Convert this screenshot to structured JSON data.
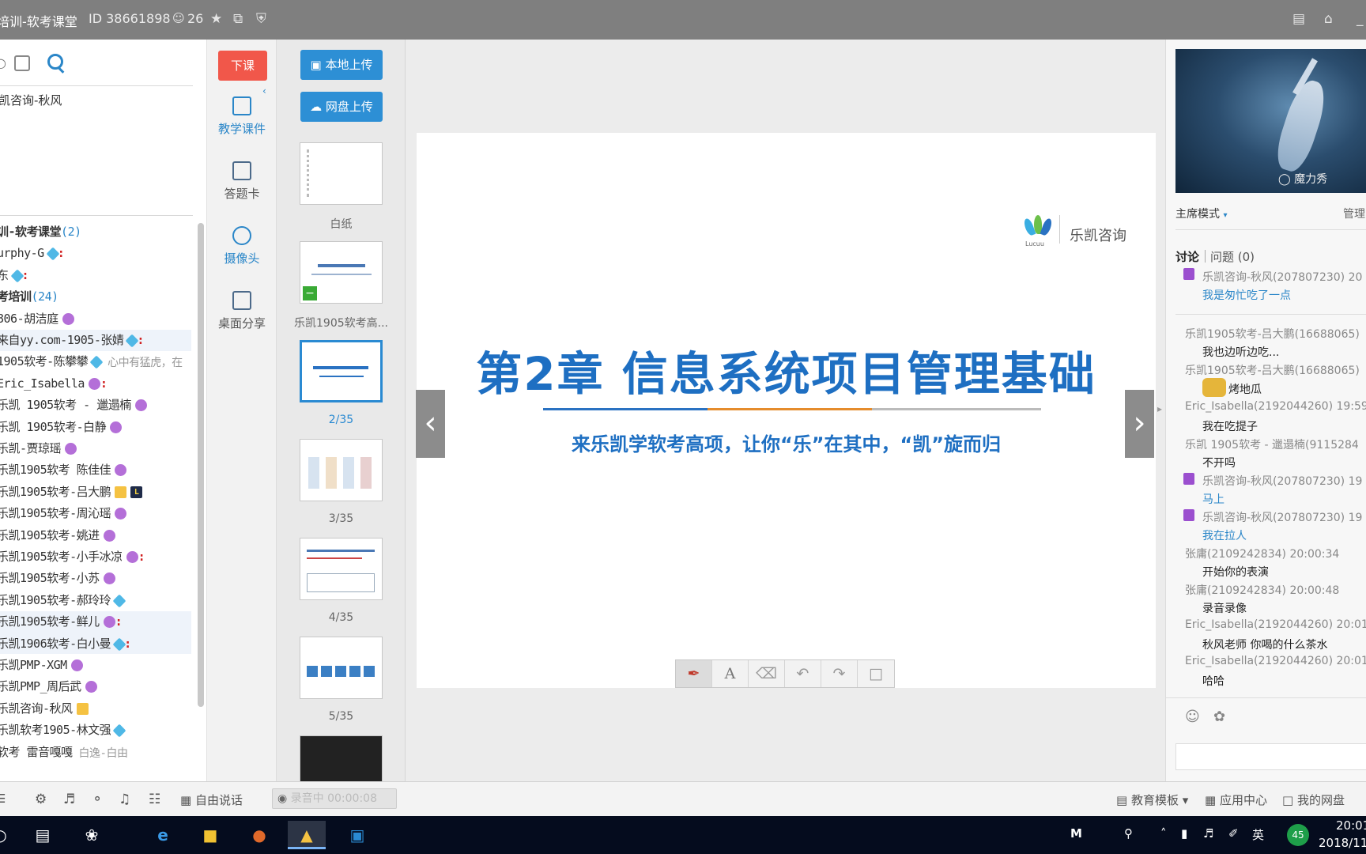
{
  "titlebar": {
    "title": "培训-软考课堂",
    "id_text": "ID 38661898",
    "members_count": "26"
  },
  "left_panel": {
    "user_name": "凯咨询-秋风",
    "members": [
      {
        "name": "训-软考课堂",
        "extra": "(2)",
        "type": "group"
      },
      {
        "name": "urphy-G",
        "badge": "diamond",
        "dot": true
      },
      {
        "name": "东",
        "badge": "diamond",
        "dot": true
      },
      {
        "name": "考培训",
        "extra": "(24)",
        "type": "group"
      },
      {
        "name": "806-胡洁庭",
        "badge": "mic"
      },
      {
        "name": "来自yy.com-1905-张婧",
        "badge": "diamond",
        "dot": true,
        "highlight": true
      },
      {
        "name": "1905软考-陈攀攀",
        "badge": "diamond",
        "signature": "心中有猛虎，在"
      },
      {
        "name": "Eric_Isabella",
        "badge": "mic",
        "dot": true
      },
      {
        "name": "乐凯 1905软考 - 邋遢楠",
        "badge": "mic"
      },
      {
        "name": "乐凯 1905软考-白静",
        "badge": "mic"
      },
      {
        "name": "乐凯-贾琼瑶",
        "badge": "mic"
      },
      {
        "name": "乐凯1905软考 陈佳佳",
        "badge": "mic"
      },
      {
        "name": "乐凯1905软考-吕大鹏",
        "badge": "crown",
        "badge2": "L"
      },
      {
        "name": "乐凯1905软考-周沁瑶",
        "badge": "mic"
      },
      {
        "name": "乐凯1905软考-姚进",
        "badge": "mic"
      },
      {
        "name": "乐凯1905软考-小手冰凉",
        "badge": "mic",
        "dot": true
      },
      {
        "name": "乐凯1905软考-小苏",
        "badge": "mic"
      },
      {
        "name": "乐凯1905软考-郝玲玲",
        "badge": "diamond"
      },
      {
        "name": "乐凯1905软考-鲜儿",
        "badge": "mic",
        "dot": true,
        "highlight": true
      },
      {
        "name": "乐凯1906软考-白小曼",
        "badge": "diamond",
        "dot": true
      },
      {
        "name": "乐凯PMP-XGM",
        "badge": "mic"
      },
      {
        "name": "乐凯PMP_周后武",
        "badge": "mic"
      },
      {
        "name": "乐凯咨询-秋风",
        "badge": "crown"
      },
      {
        "name": "乐凯软考1905-林文强",
        "badge": "diamond"
      },
      {
        "name": "软考 雷音嘎嘎",
        "signature": "白逸-白由"
      }
    ]
  },
  "tools": {
    "end_class": "下课",
    "courseware": "教学课件",
    "answer_card": "答题卡",
    "camera": "摄像头",
    "desktop_share": "桌面分享"
  },
  "courseware": {
    "local_upload": "本地上传",
    "cloud_upload": "网盘上传",
    "thumbs": [
      {
        "label": "白纸"
      },
      {
        "label": "乐凯1905软考高..."
      },
      {
        "label": "2/35",
        "selected": true
      },
      {
        "label": "3/35"
      },
      {
        "label": "4/35"
      },
      {
        "label": "5/35"
      }
    ]
  },
  "slide": {
    "brand": "乐凯咨询",
    "brand_small": "Lucuu",
    "title": "第2章  信息系统项目管理基础",
    "subtitle": "来乐凯学软考高项，让你“乐”在其中，“凯”旋而归"
  },
  "right_panel": {
    "video_watermark": "魔力秀",
    "mode": "主席模式",
    "manage": "管理",
    "tab_discuss": "讨论",
    "tab_question": "问题 (0)",
    "messages": [
      {
        "sender": "乐凯咨询-秋风(207807230) 20",
        "text": "我是匆忙吃了一点",
        "teacher": true
      },
      {
        "sender": "乐凯1905软考-吕大鹏(16688065)",
        "text": "我也边听边吃..."
      },
      {
        "sender": "乐凯1905软考-吕大鹏(16688065)",
        "text": "烤地瓜"
      },
      {
        "sender": "Eric_Isabella(2192044260) 19:59",
        "text": "我在吃提子"
      },
      {
        "sender": "乐凯 1905软考 - 邋遢楠(9115284",
        "text": "不开吗"
      },
      {
        "sender": "乐凯咨询-秋风(207807230) 19",
        "text": "马上",
        "teacher": true
      },
      {
        "sender": "乐凯咨询-秋风(207807230) 19",
        "text": "我在拉人",
        "teacher": true
      },
      {
        "sender": "张庸(2109242834) 20:00:34",
        "text": "开始你的表演"
      },
      {
        "sender": "张庸(2109242834) 20:00:48",
        "text": "录音录像"
      },
      {
        "sender": "Eric_Isabella(2192044260) 20:01",
        "text": "秋风老师 你喝的什么茶水"
      },
      {
        "sender": "Eric_Isabella(2192044260) 20:01",
        "text": "哈哈"
      }
    ]
  },
  "statusbar": {
    "free_speech": "自由说话",
    "recording": "录音中 00:00:08",
    "edu_template": "教育模板",
    "app_center": "应用中心",
    "my_cloud": "我的网盘"
  },
  "taskbar": {
    "ime": "英",
    "badge_count": "45",
    "time": "20:01",
    "date": "2018/11"
  },
  "colors": {
    "accent_blue": "#2d8fd5",
    "end_red": "#f1574a",
    "slide_title_blue": "#1e6fc2"
  }
}
